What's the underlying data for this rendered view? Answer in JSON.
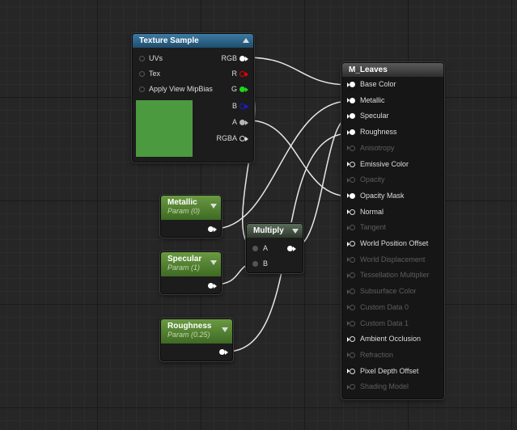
{
  "texture_sample": {
    "title": "Texture Sample",
    "inputs": [
      "UVs",
      "Tex",
      "Apply View MipBias"
    ],
    "outputs": [
      "RGB",
      "R",
      "G",
      "B",
      "A",
      "RGBA"
    ],
    "preview_color": "#4c9a3f"
  },
  "metallic_param": {
    "title": "Metallic",
    "subtitle": "Param (0)"
  },
  "specular_param": {
    "title": "Specular",
    "subtitle": "Param (1)"
  },
  "roughness_param": {
    "title": "Roughness",
    "subtitle": "Param (0.25)"
  },
  "multiply": {
    "title": "Multiply",
    "inputs": [
      "A",
      "B"
    ]
  },
  "material": {
    "title": "M_Leaves",
    "inputs": [
      {
        "label": "Base Color",
        "active": true,
        "connected": true
      },
      {
        "label": "Metallic",
        "active": true,
        "connected": true
      },
      {
        "label": "Specular",
        "active": true,
        "connected": true
      },
      {
        "label": "Roughness",
        "active": true,
        "connected": true
      },
      {
        "label": "Anisotropy",
        "active": false,
        "connected": false
      },
      {
        "label": "Emissive Color",
        "active": true,
        "connected": false
      },
      {
        "label": "Opacity",
        "active": false,
        "connected": false
      },
      {
        "label": "Opacity Mask",
        "active": true,
        "connected": true
      },
      {
        "label": "Normal",
        "active": true,
        "connected": false
      },
      {
        "label": "Tangent",
        "active": false,
        "connected": false
      },
      {
        "label": "World Position Offset",
        "active": true,
        "connected": false
      },
      {
        "label": "World Displacement",
        "active": false,
        "connected": false
      },
      {
        "label": "Tessellation Multiplier",
        "active": false,
        "connected": false
      },
      {
        "label": "Subsurface Color",
        "active": false,
        "connected": false
      },
      {
        "label": "Custom Data 0",
        "active": false,
        "connected": false
      },
      {
        "label": "Custom Data 1",
        "active": false,
        "connected": false
      },
      {
        "label": "Ambient Occlusion",
        "active": true,
        "connected": false
      },
      {
        "label": "Refraction",
        "active": false,
        "connected": false
      },
      {
        "label": "Pixel Depth Offset",
        "active": true,
        "connected": false
      },
      {
        "label": "Shading Model",
        "active": false,
        "connected": false
      }
    ]
  },
  "colors": {
    "wire": "#e6e6e6",
    "texture_header": "#2f6890",
    "param_header": "#5a8a34",
    "preview": "#4c9a3f"
  }
}
